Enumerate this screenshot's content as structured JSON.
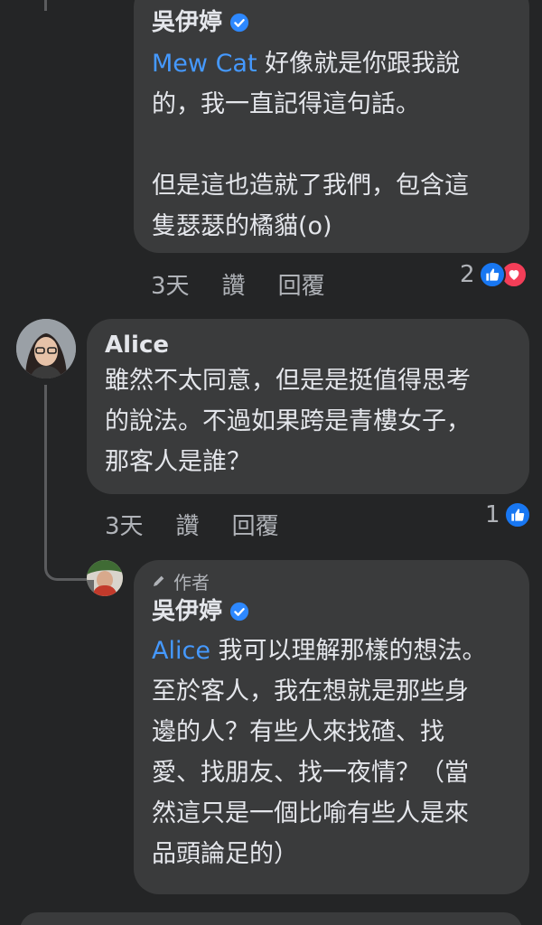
{
  "comments": [
    {
      "author": "吳伊婷",
      "mention": "Mew Cat",
      "line1": " 好像就是你跟我說",
      "rest": "的，我一直記得這句話。\n\n但是這也造就了我們，包含這\n隻瑟瑟的橘貓(o)",
      "time": "3天",
      "like_label": "讚",
      "reply_label": "回覆",
      "reaction_count": "2",
      "reactions": [
        "like-icon",
        "love-icon"
      ]
    },
    {
      "author": "Alice",
      "text": "雖然不太同意，但是是挺值得思考\n的說法。不過如果跨是青樓女子，\n那客人是誰？",
      "time": "3天",
      "like_label": "讚",
      "reply_label": "回覆",
      "reaction_count": "1",
      "reactions": [
        "like-icon"
      ]
    },
    {
      "author_tag": "作者",
      "author": "吳伊婷",
      "mention": "Alice",
      "line1": " 我可以理解那樣的想法。",
      "rest": "至於客人，我在想就是那些身\n邊的人？有些人來找碴、找\n愛、找朋友、找一夜情？（當\n然這只是一個比喻有些人是來\n品頭論足的）"
    }
  ],
  "colors": {
    "background": "#242526",
    "bubble": "#3a3b3c",
    "mention": "#4599ff",
    "verified": "#2d88ff",
    "like": "#1877f2",
    "love": "#f33e58"
  }
}
